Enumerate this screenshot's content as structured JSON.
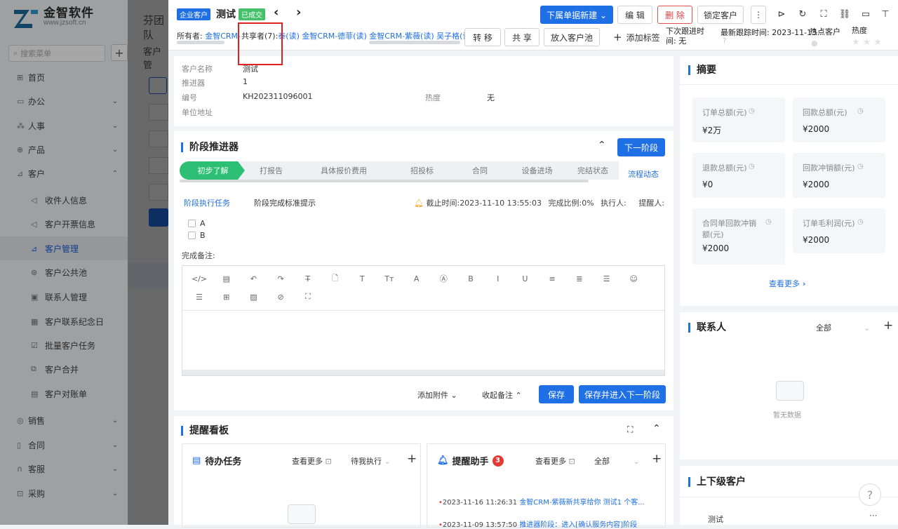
{
  "app": {
    "logo_name": "金智软件",
    "logo_url_text": "www.jzsoft.cn",
    "peek_title": "芬团队",
    "peek_subtitle": "客户管"
  },
  "sidebar": {
    "search_placeholder": "搜索菜单",
    "add_label": "+",
    "items": [
      {
        "label": "首页",
        "icon": "home-icon",
        "glyph": "⊞",
        "chev": ""
      },
      {
        "label": "办公",
        "icon": "office-icon",
        "glyph": "▭",
        "chev": "⌄"
      },
      {
        "label": "人事",
        "icon": "people-icon",
        "glyph": "⁂",
        "chev": "⌄"
      },
      {
        "label": "产品",
        "icon": "product-icon",
        "glyph": "⊕",
        "chev": "⌄"
      },
      {
        "label": "客户",
        "icon": "customer-icon",
        "glyph": "⊿",
        "chev": "⌃"
      },
      {
        "label": "收件人信息",
        "icon": "recipient-icon",
        "glyph": "◁",
        "chev": ""
      },
      {
        "label": "客户开票信息",
        "icon": "invoice-icon",
        "glyph": "◁",
        "chev": ""
      },
      {
        "label": "客户管理",
        "icon": "customer-manage-icon",
        "glyph": "⊿",
        "chev": ""
      },
      {
        "label": "客户公共池",
        "icon": "public-pool-icon",
        "glyph": "⊛",
        "chev": ""
      },
      {
        "label": "联系人管理",
        "icon": "contact-icon",
        "glyph": "▣",
        "chev": ""
      },
      {
        "label": "客户联系纪念日",
        "icon": "anniversary-icon",
        "glyph": "▦",
        "chev": ""
      },
      {
        "label": "批量客户任务",
        "icon": "batch-task-icon",
        "glyph": "☑",
        "chev": ""
      },
      {
        "label": "客户合并",
        "icon": "merge-icon",
        "glyph": "⧉",
        "chev": ""
      },
      {
        "label": "客户对账单",
        "icon": "statement-icon",
        "glyph": "▤",
        "chev": ""
      },
      {
        "label": "销售",
        "icon": "sales-icon",
        "glyph": "◎",
        "chev": "⌄"
      },
      {
        "label": "合同",
        "icon": "contract-icon",
        "glyph": "▯",
        "chev": "⌄"
      },
      {
        "label": "客服",
        "icon": "service-icon",
        "glyph": "∩",
        "chev": "⌄"
      },
      {
        "label": "采购",
        "icon": "purchase-icon",
        "glyph": "⊡",
        "chev": "⌄"
      }
    ]
  },
  "header": {
    "badge_type": "企业客户",
    "customer_name": "测试",
    "badge_status": "已成交",
    "prev_label": "‹",
    "next_label": "›",
    "btn_sub_create": "下属单据新建 ⌄",
    "btn_edit": "编 辑",
    "btn_delete": "删 除",
    "btn_lock": "锁定客户",
    "owner_label": "所有者:",
    "owner_value": "金智CRM-",
    "sharer_label": "共享者(7):",
    "sharer_values": [
      "泰(读)",
      "金智CRM-德菲(读)",
      "金智CRM-紫薇(读)",
      "吴子格(读)"
    ],
    "btn_transfer": "转 移",
    "btn_share": "共 享",
    "btn_pool": "放入客户池",
    "add_tag": "添加标签",
    "next_follow_label": "下次跟进时间:",
    "next_follow_value": "无",
    "last_follow_label": "最新跟踪时间:",
    "last_follow_value": "2023-11-13",
    "hot_label": "热点客户",
    "heat_label": "热度"
  },
  "info": {
    "rows": [
      {
        "label": "客户名称",
        "value": "测试"
      },
      {
        "label": "推进器",
        "value": "1"
      },
      {
        "label": "编号",
        "value": "KH202311096001"
      },
      {
        "label": "单位地址",
        "value": ""
      }
    ],
    "heat_label": "热度",
    "heat_value": "无"
  },
  "stage": {
    "title": "阶段推进器",
    "next_btn": "下一阶段",
    "flow_link": "流程动态",
    "stages": [
      "初步了解",
      "打报告",
      "具体报价费用",
      "招投标",
      "合同",
      "设备进场",
      "完结状态"
    ],
    "task_tab": "阶段执行任务",
    "hint_tab": "阶段完成标准提示",
    "deadline_label": "截止时间:",
    "deadline_value": "2023-11-10 13:55:03",
    "ratio_label": "完成比例:",
    "ratio_value": "0%",
    "executor_label": "执行人:",
    "reminder_label": "提醒人:",
    "tasks": [
      "A",
      "B"
    ],
    "remark_label": "完成备注:",
    "add_attachment": "添加附件 ⌄",
    "collapse_remark": "收起备注 ⌃",
    "save": "保存",
    "save_next": "保存并进入下一阶段"
  },
  "editor": {
    "row1": [
      "</>",
      "▤",
      "↶",
      "↷",
      "T̶",
      "🗋",
      "T",
      "Tт",
      "A",
      "Ⓐ",
      "B",
      "I",
      "U",
      "≡",
      "≣",
      "☰",
      "☺"
    ],
    "row2": [
      "☰",
      "⊞",
      "▨",
      "⊘",
      "⛶"
    ]
  },
  "board": {
    "title": "提醒看板",
    "todo_title": "待办任务",
    "todo_more": "查看更多",
    "todo_filter": "待我执行",
    "assistant_title": "提醒助手",
    "assistant_count": "3",
    "assistant_more": "查看更多",
    "assistant_filter": "全部",
    "messages": [
      {
        "time": "2023-11-16 11:26:31",
        "text": "金智CRM-紫薇新共享给你 测试1 个客..."
      },
      {
        "time": "2023-11-09 13:57:50",
        "text": "推进器阶段：进入[确认服务内容]阶段"
      }
    ]
  },
  "summary": {
    "title": "摘要",
    "items": [
      {
        "label": "订单总额(元)",
        "value": "¥2万"
      },
      {
        "label": "回款总额(元)",
        "value": "¥2000"
      },
      {
        "label": "退款总额(元)",
        "value": "¥0"
      },
      {
        "label": "回款冲销额(元)",
        "value": "¥2000"
      },
      {
        "label": "合同单回款冲销额(元)",
        "value": "¥2000"
      },
      {
        "label": "订单毛利润(元)",
        "value": "¥2000"
      }
    ],
    "more": "查看更多"
  },
  "contacts": {
    "title": "联系人",
    "filter": "全部",
    "empty": "暂无数据"
  },
  "parent": {
    "title": "上下级客户",
    "row": "测试"
  }
}
